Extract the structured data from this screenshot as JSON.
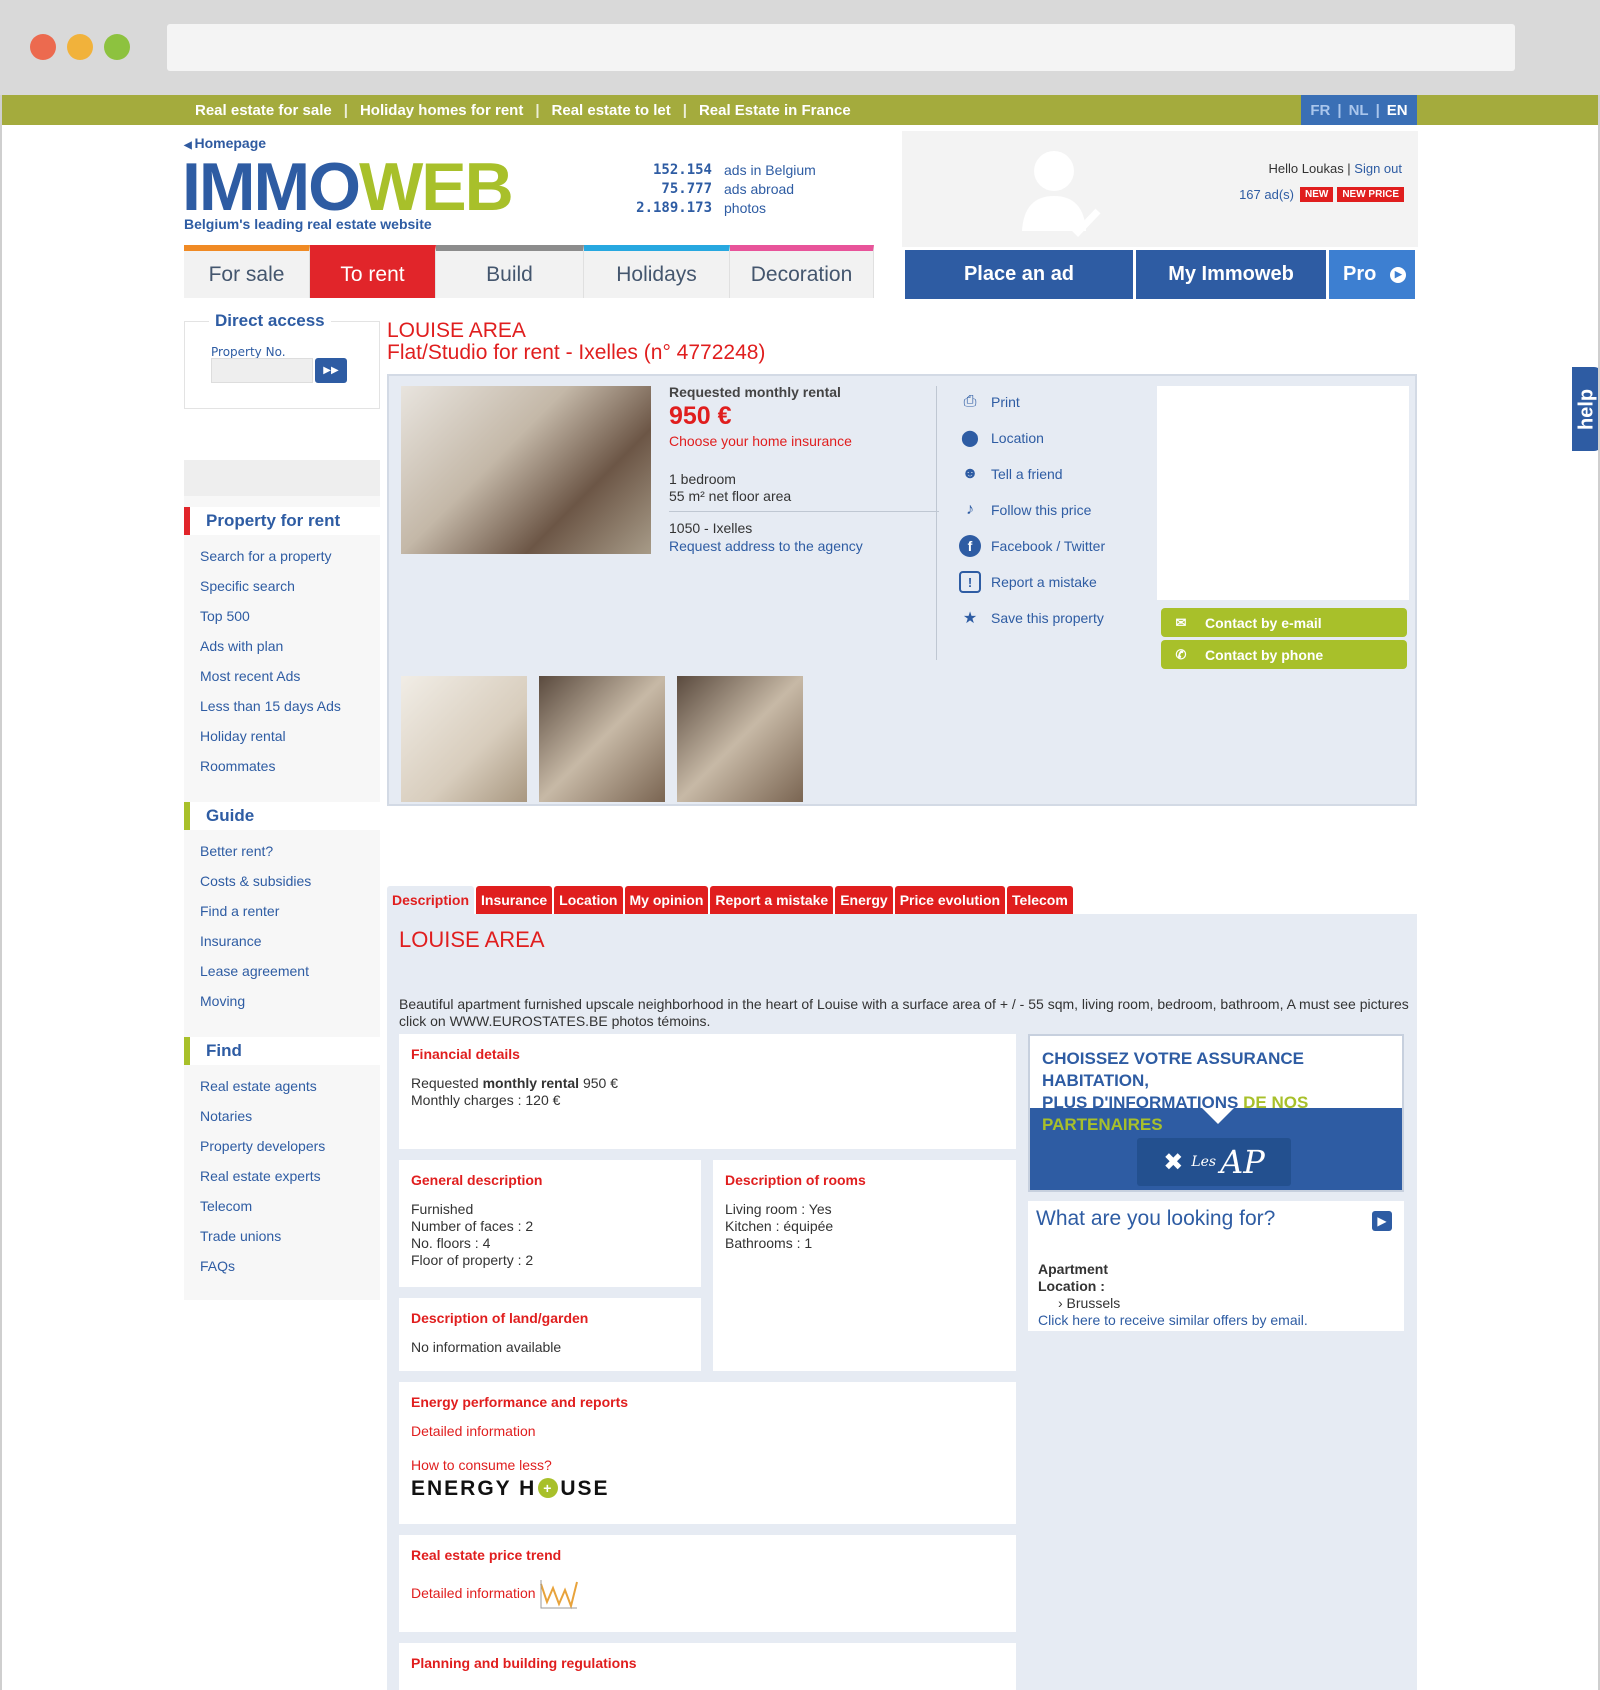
{
  "topbar": {
    "links": [
      "Real estate for sale",
      "Holiday homes for rent",
      "Real estate to let",
      "Real Estate in France"
    ],
    "langs": [
      "FR",
      "NL",
      "EN"
    ],
    "active_lang": "EN"
  },
  "header": {
    "homepage": "Homepage",
    "logo_part1": "IMMO",
    "logo_part2": "WEB",
    "tagline": "Belgium's leading real estate website",
    "stats": [
      {
        "num": "152.154",
        "label": "ads in Belgium"
      },
      {
        "num": "75.777",
        "label": "ads abroad"
      },
      {
        "num": "2.189.173",
        "label": "photos"
      }
    ],
    "hello": "Hello Loukas",
    "signout": "Sign out",
    "ads_link": "167  ad(s)",
    "badge_new": "NEW",
    "badge_new_price": "NEW PRICE"
  },
  "nav": {
    "tabs": [
      "For sale",
      "To rent",
      "Build",
      "Holidays",
      "Decoration"
    ],
    "active": "To rent",
    "colors": [
      "#f08a24",
      "#e1252a",
      "#8c8c8c",
      "#27a8e0",
      "#e8549a"
    ],
    "buttons": [
      "Place an ad",
      "My Immoweb",
      "Pro"
    ]
  },
  "help": "help",
  "direct_access": {
    "title": "Direct access",
    "label": "Property No."
  },
  "sidebar": {
    "sections": [
      {
        "title": "Property for rent",
        "color": "#e1252a",
        "items": [
          "Search for a property",
          "Specific search",
          "Top 500",
          "Ads with plan",
          "Most recent Ads",
          "Less than 15 days Ads",
          "Holiday rental",
          "Roommates"
        ]
      },
      {
        "title": "Guide",
        "color": "#a8c02a",
        "items": [
          "Better rent?",
          "Costs & subsidies",
          "Find a renter",
          "Insurance",
          "Lease agreement",
          "Moving"
        ]
      },
      {
        "title": "Find",
        "color": "#a8c02a",
        "items": [
          "Real estate agents",
          "Notaries",
          "Property developers",
          "Real estate experts",
          "Telecom",
          "Trade unions",
          "FAQs"
        ]
      }
    ]
  },
  "listing": {
    "title1": "LOUISE AREA",
    "title2": "Flat/Studio  for rent - Ixelles  (n° 4772248)",
    "rent_label": "Requested monthly rental",
    "price": "950 €",
    "insurance_link": "Choose your home insurance",
    "bedrooms": "1 bedroom",
    "area": "55 m² net floor area",
    "location": "1050  -  Ixelles",
    "address_link": "Request address to the agency",
    "actions": [
      "Print",
      "Location",
      "Tell a friend",
      "Follow this price",
      "Facebook / Twitter",
      "Report a mistake",
      "Save this property"
    ],
    "contact_email": "Contact by e-mail",
    "contact_phone": "Contact by phone"
  },
  "detail_tabs": [
    "Description",
    "Insurance",
    "Location",
    "My opinion",
    "Report a mistake",
    "Energy",
    "Price evolution",
    "Telecom"
  ],
  "description": {
    "heading": "LOUISE AREA",
    "text": "Beautiful apartment furnished upscale neighborhood in the heart of Louise with a surface area of + / - 55 sqm, living room, bedroom, bathroom, A must see pictures click on WWW.EUROSTATES.BE photos témoins.",
    "financial": {
      "title": "Financial details",
      "line1_pre": "Requested ",
      "line1_bold": "monthly rental",
      "line1_post": " 950 €",
      "line2": "Monthly charges : 120 €"
    },
    "general": {
      "title": "General description",
      "lines": [
        "Furnished",
        "Number of faces : 2",
        "No. floors : 4",
        "Floor of property : 2"
      ]
    },
    "rooms": {
      "title": "Description of rooms",
      "lines": [
        "Living room : Yes",
        "Kitchen : équipée",
        "Bathrooms : 1"
      ]
    },
    "land": {
      "title": "Description of land/garden",
      "text": "No information available"
    },
    "energy": {
      "title": "Energy performance and reports",
      "link1": "Detailed information",
      "link2": "How to consume less?",
      "logo_text1": "ENERGY H",
      "logo_text2": "USE"
    },
    "trend": {
      "title": "Real estate price trend",
      "link": "Detailed information"
    },
    "planning": {
      "title": "Planning and building regulations"
    }
  },
  "ad": {
    "line1": "CHOISSEZ VOTRE ASSURANCE HABITATION,",
    "line2_a": "PLUS D'INFORMATIONS ",
    "line2_b": "DE NOS PARTENAIRES",
    "line2_c": " !",
    "logo_small": "Les",
    "logo_big": "AP"
  },
  "looking": {
    "title": "What are you looking for?",
    "type": "Apartment",
    "location_label": "Location  :",
    "location": "› Brussels",
    "link": "Click here to receive similar offers by email."
  }
}
